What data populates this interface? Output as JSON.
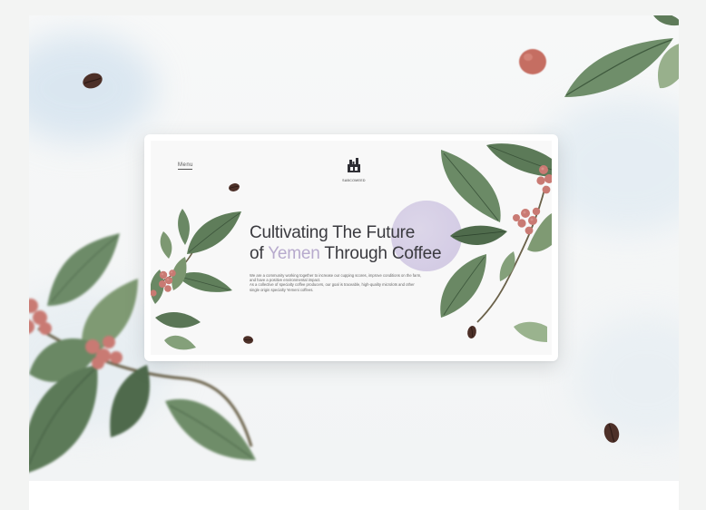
{
  "site": {
    "menu_label": "Menu",
    "logo_name": "SABCOMEED",
    "headline_line1": "Cultivating The Future",
    "headline_of": "of",
    "headline_accent": "Yemen",
    "headline_rest": "Through Coffee",
    "description_1": "We are a community working together to increase our cupping scores, improve conditions on the farm, and have a positive environmental impact.",
    "description_2": "As a collective of specialty coffee producers, our goal is traceable, high-quality microlots and other single origin specialty Yemeni coffees."
  },
  "colors": {
    "accent_purple": "#b7aacd",
    "leaf_green": "#5f7d5a",
    "berry_red": "#c8706a",
    "bean_brown": "#5a3a30"
  },
  "icons": [
    "coffee-bean-icon",
    "coffee-berry-icon",
    "leaf-icon",
    "logo-icon"
  ]
}
